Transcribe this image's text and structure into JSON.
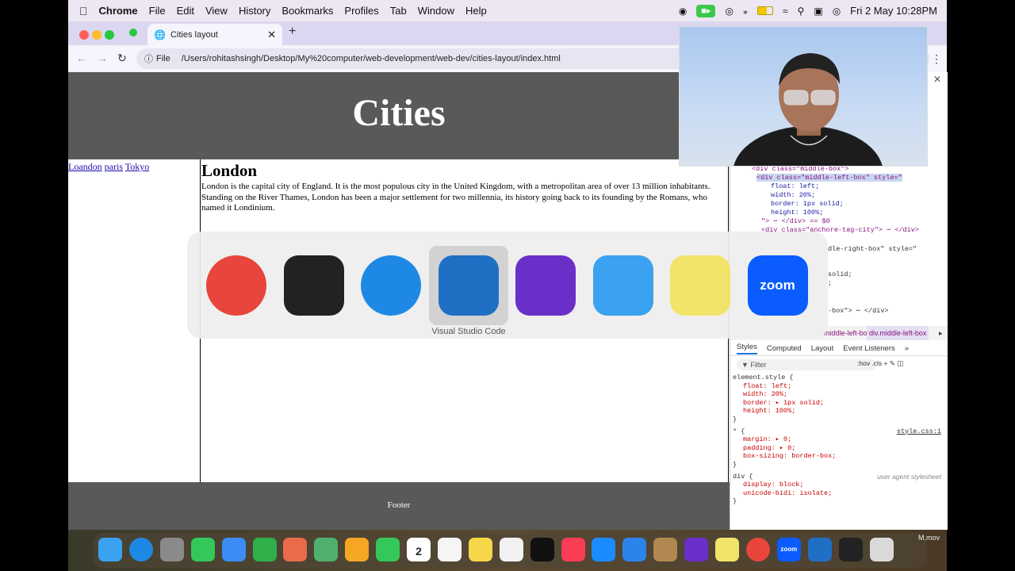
{
  "menubar": {
    "app_name": "Chrome",
    "items": [
      "File",
      "Edit",
      "View",
      "History",
      "Bookmarks",
      "Profiles",
      "Tab",
      "Window",
      "Help"
    ],
    "datetime": "Fri 2 May  10:28PM"
  },
  "browser": {
    "tab_title": "Cities layout",
    "url_scheme_label": "File",
    "url": "/Users/rohitashsingh/Desktop/My%20computer/web-development/web-dev/cities-layout/index.html"
  },
  "page": {
    "header_title": "Cities",
    "nav_links": [
      "Loandon",
      "paris",
      "Tokyo"
    ],
    "article_title": "London",
    "paragraphs": [
      "London is the capital city of England. It is the most populous city in the United Kingdom, with a metropolitan area of over 13 million inhabitants.",
      "Standing on the River Thames, London has been a major settlement for two millennia, its history going back to its founding by the Romans, who named it Londinium."
    ],
    "footer_text": "Footer"
  },
  "devtools": {
    "dom_lines": [
      {
        "indent": 4,
        "html": "<div class=\"middle-box\">"
      },
      {
        "indent": 5,
        "html": "<div class=\"middle-left-box\" style=\""
      },
      {
        "indent": 8,
        "html": "float: left;"
      },
      {
        "indent": 8,
        "html": "width: 20%;"
      },
      {
        "indent": 8,
        "html": "border: 1px solid;"
      },
      {
        "indent": 8,
        "html": "height: 100%;"
      },
      {
        "indent": 6,
        "html": "\"> ⋯ </div> == $0"
      },
      {
        "indent": 6,
        "html": "<div class=\"anchore-tag-city\"> ⋯ </div>"
      }
    ],
    "partial_lines": [
      "dle-right-box\" style=\"",
      "solid;",
      ";",
      "-box\"> ⋯ </div>"
    ],
    "breadcrumb": [
      "middle-left-box",
      "div.middle-left-box"
    ],
    "panel_tabs": [
      "Styles",
      "Computed",
      "Layout",
      "Event Listeners"
    ],
    "filter_placeholder": "Filter",
    "filter_tools": ":hov  .cls  +",
    "rules": [
      {
        "selector": "element.style {",
        "source": "",
        "decls": [
          "float: left;",
          "width: 20%;",
          "border: ▸ 1px solid;",
          "height: 100%;"
        ]
      },
      {
        "selector": "* {",
        "source": "style.css:1",
        "decls": [
          "margin: ▸ 0;",
          "padding: ▸ 0;",
          "box-sizing: border-box;"
        ]
      },
      {
        "selector": "div {",
        "source": "user agent stylesheet",
        "decls": [
          "display: block;",
          "unicode-bidi: isolate;"
        ]
      }
    ],
    "closing_brace": "}"
  },
  "app_switcher": {
    "selected_label": "Visual Studio Code",
    "apps": [
      {
        "name": "chrome-icon",
        "color": "#e8453c"
      },
      {
        "name": "quicktime-icon",
        "color": "#222222"
      },
      {
        "name": "safari-icon",
        "color": "#1e88e5"
      },
      {
        "name": "vscode-icon",
        "color": "#1f6fc5"
      },
      {
        "name": "imovie-icon",
        "color": "#6a2fc9"
      },
      {
        "name": "finder-icon",
        "color": "#3aa2f0"
      },
      {
        "name": "stickies-icon",
        "color": "#f2e36a"
      },
      {
        "name": "zoom-icon",
        "color": "#0b5cff"
      }
    ]
  },
  "dock": {
    "icons": [
      {
        "name": "finder-icon",
        "color": "#3aa2f0"
      },
      {
        "name": "safari-icon",
        "color": "#1e88e5"
      },
      {
        "name": "system-settings-icon",
        "color": "#8a8a8a"
      },
      {
        "name": "messages-icon",
        "color": "#34c759"
      },
      {
        "name": "mail-icon",
        "color": "#3b8df5"
      },
      {
        "name": "numbers-icon",
        "color": "#2fb04a"
      },
      {
        "name": "launchpad-icon",
        "color": "#e96b4a"
      },
      {
        "name": "maps-icon",
        "color": "#4fb06d"
      },
      {
        "name": "photos-icon",
        "color": "#f5a623"
      },
      {
        "name": "facetime-icon",
        "color": "#34c759"
      },
      {
        "name": "calendar-icon",
        "color": "#ffffff"
      },
      {
        "name": "reminders-icon",
        "color": "#f5f5f5"
      },
      {
        "name": "notes-icon",
        "color": "#f7d74a"
      },
      {
        "name": "freeform-icon",
        "color": "#f1f1f1"
      },
      {
        "name": "apple-tv-icon",
        "color": "#111111"
      },
      {
        "name": "music-icon",
        "color": "#fa3c55"
      },
      {
        "name": "app-store-icon",
        "color": "#1a8cff"
      },
      {
        "name": "keynote-icon",
        "color": "#2a84ea"
      },
      {
        "name": "contacts-icon",
        "color": "#b08850"
      },
      {
        "name": "imovie-icon",
        "color": "#6a2fc9"
      },
      {
        "name": "stickies-icon",
        "color": "#f2e36a"
      },
      {
        "name": "chrome-icon",
        "color": "#e8453c"
      },
      {
        "name": "zoom-icon",
        "color": "#0b5cff"
      },
      {
        "name": "vscode-icon",
        "color": "#1f6fc5"
      },
      {
        "name": "quicktime-icon",
        "color": "#222222"
      },
      {
        "name": "trash-icon",
        "color": "#d9d9d9"
      }
    ],
    "recording_label": "M.mov"
  },
  "calendar_icon": {
    "month": "MAY",
    "day": "2"
  },
  "zoom_label": "zoom"
}
